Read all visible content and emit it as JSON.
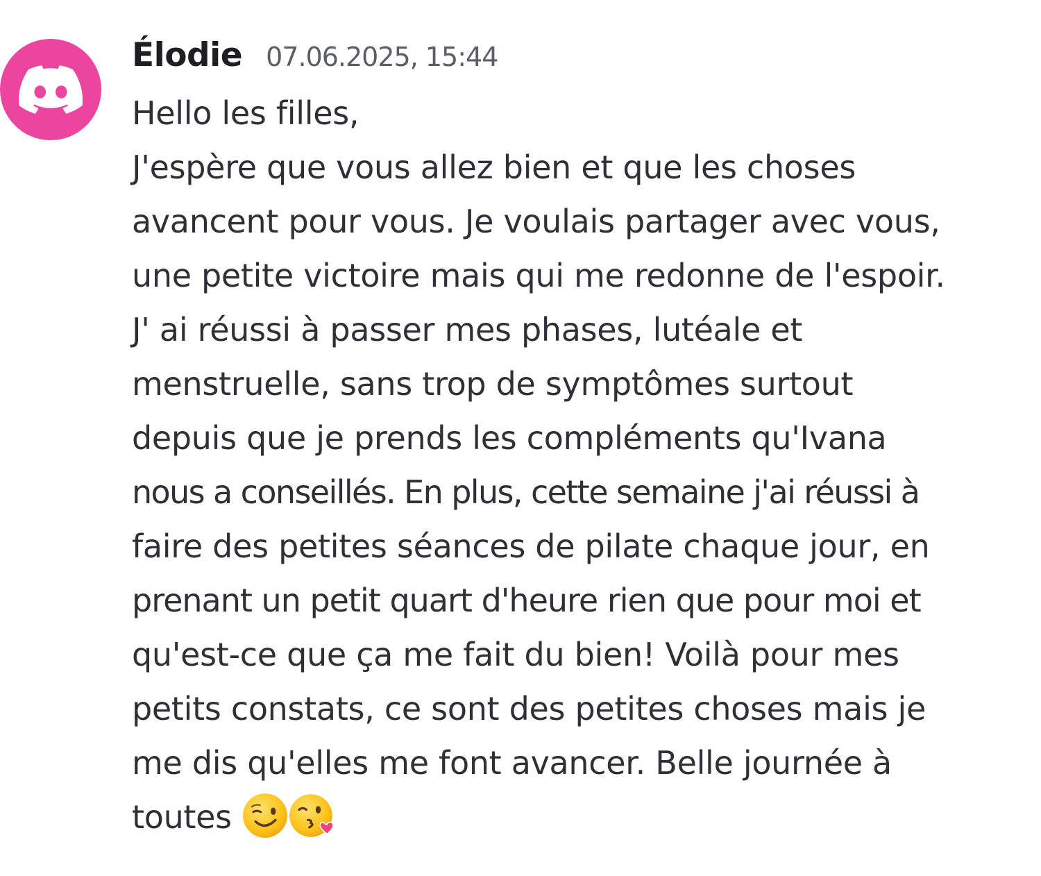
{
  "message": {
    "author": "Élodie",
    "timestamp": "07.06.2025, 15:44",
    "avatar_icon": "discord-logo-icon",
    "avatar_color": "#eb459f",
    "lines": [
      "Hello les filles,",
      "J'espère que vous allez bien et que les choses",
      "avancent pour vous. Je voulais partager avec vous,",
      "une petite victoire mais qui me redonne de l'espoir.",
      "J' ai réussi à passer mes phases, lutéale et",
      "menstruelle, sans trop de symptômes surtout",
      "depuis que je prends les compléments qu'Ivana",
      "nous a conseillés. En plus, cette semaine j'ai réussi à",
      "faire des petites séances de pilate chaque jour, en",
      "prenant un petit quart d'heure rien que pour moi et",
      "qu'est-ce que ça me fait du bien! Voilà pour mes",
      "petits constats, ce sont des petites choses mais je",
      "me dis qu'elles me font avancer. Belle journée à",
      "toutes"
    ],
    "emojis": [
      "winking-face-icon",
      "face-blowing-kiss-icon"
    ]
  }
}
